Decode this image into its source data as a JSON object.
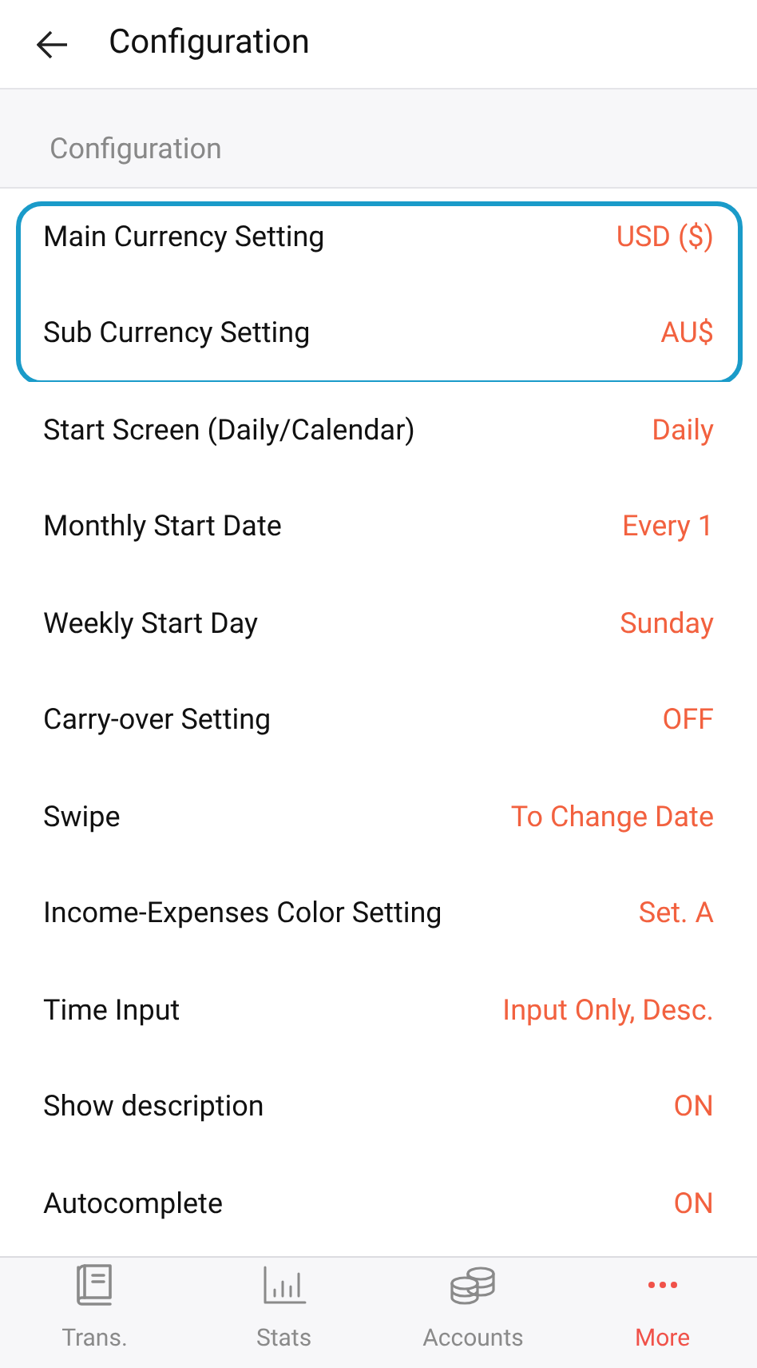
{
  "header": {
    "title": "Configuration"
  },
  "section": {
    "title": "Configuration"
  },
  "settings": [
    {
      "label": "Main Currency Setting",
      "value": "USD ($)",
      "highlighted": true
    },
    {
      "label": "Sub Currency Setting",
      "value": "AU$",
      "highlighted": true
    },
    {
      "label": "Start Screen (Daily/Calendar)",
      "value": "Daily",
      "highlighted": false
    },
    {
      "label": "Monthly Start Date",
      "value": "Every 1",
      "highlighted": false
    },
    {
      "label": "Weekly Start Day",
      "value": "Sunday",
      "highlighted": false
    },
    {
      "label": "Carry-over Setting",
      "value": "OFF",
      "highlighted": false
    },
    {
      "label": "Swipe",
      "value": "To Change Date",
      "highlighted": false
    },
    {
      "label": "Income-Expenses Color Setting",
      "value": "Set. A",
      "highlighted": false
    },
    {
      "label": "Time Input",
      "value": "Input Only, Desc.",
      "highlighted": false
    },
    {
      "label": "Show description",
      "value": "ON",
      "highlighted": false
    },
    {
      "label": "Autocomplete",
      "value": "ON",
      "highlighted": false
    }
  ],
  "nav": [
    {
      "kind": "book",
      "label": "Trans.",
      "selected": false
    },
    {
      "kind": "stats",
      "label": "Stats",
      "selected": false
    },
    {
      "kind": "coins",
      "label": "Accounts",
      "selected": false
    },
    {
      "kind": "more",
      "label": "More",
      "selected": true
    }
  ]
}
